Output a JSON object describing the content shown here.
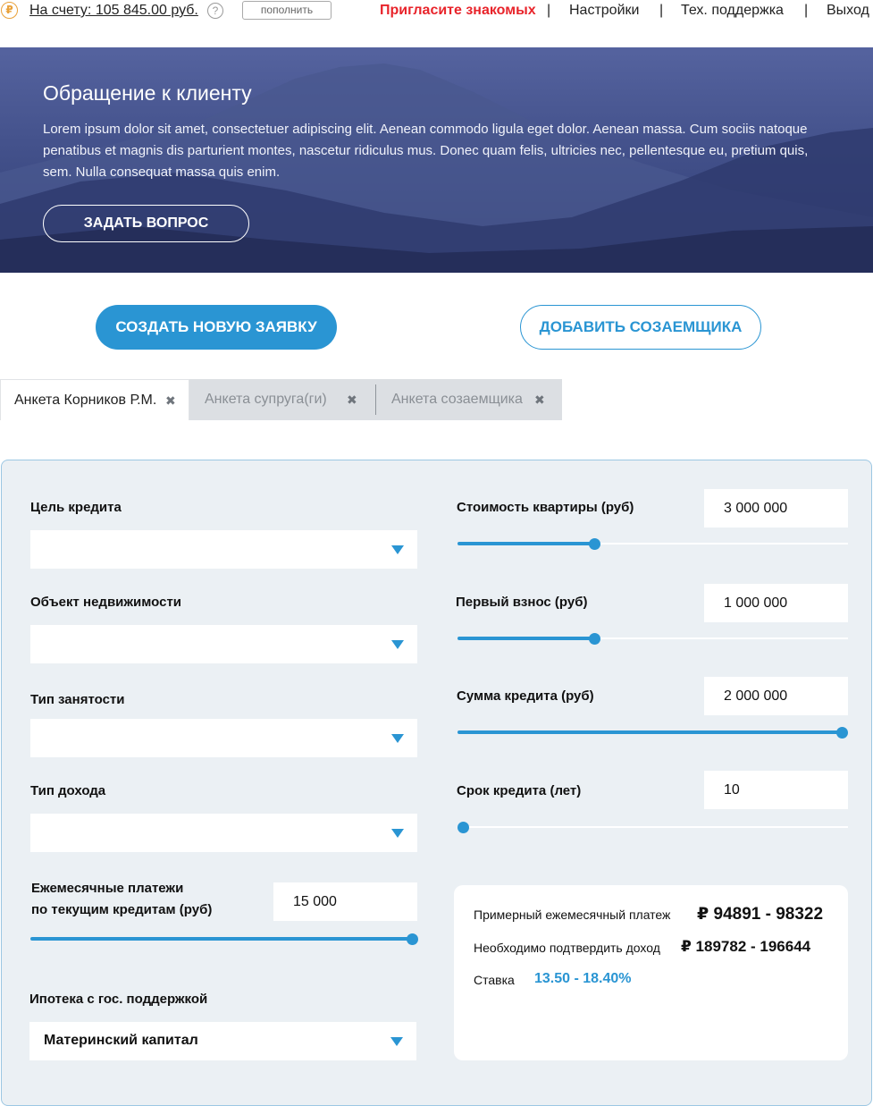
{
  "topbar": {
    "coin_icon": "ruble-coin-icon",
    "balance": "На счету: 105 845.00 руб.",
    "help_icon": "?",
    "topup_label": "пополнить",
    "invite": "Пригласите знакомых",
    "settings": "Настройки",
    "support": "Тех. поддержка",
    "logout": "Выход",
    "separator": "|"
  },
  "hero": {
    "title": "Обращение к клиенту",
    "text": "Lorem ipsum dolor sit amet, consectetuer adipiscing elit. Aenean commodo ligula eget dolor. Aenean massa. Cum sociis natoque penatibus et magnis dis parturient montes, nascetur ridiculus mus. Donec quam felis, ultricies nec, pellentesque eu, pretium quis, sem. Nulla consequat massa quis enim.",
    "button": "ЗАДАТЬ ВОПРОС"
  },
  "actions": {
    "create": "СОЗДАТЬ НОВУЮ ЗАЯВКУ",
    "add_coborrower": "ДОБАВИТЬ СОЗАЕМЩИКА"
  },
  "tabs": [
    {
      "label": "Анкета Корников Р.М.",
      "close": "✖",
      "active": true
    },
    {
      "label": "Анкета супруга(ги)",
      "close": "✖",
      "active": false
    },
    {
      "label": "Анкета созаемщика",
      "close": "✖",
      "active": false
    }
  ],
  "form": {
    "purpose_label": "Цель кредита",
    "property_label": "Объект недвижимости",
    "employment_label": "Тип занятости",
    "income_label": "Тип дохода",
    "monthly_label_line1": "Ежемесячные платежи",
    "monthly_label_line2": "по текущим кредитам (руб)",
    "monthly_value": "15 000",
    "monthly_slider": 1.0,
    "gov_label": "Ипотека с гос. поддержкой",
    "gov_value": "Материнский капитал",
    "price_label": "Стоимость квартиры (руб)",
    "price_value": "3 000 000",
    "price_slider": 0.35,
    "downpayment_label": "Первый взнос (руб)",
    "downpayment_value": "1 000 000",
    "downpayment_slider": 0.35,
    "loan_label": "Сумма кредита (руб)",
    "loan_value": "2 000 000",
    "loan_slider": 1.0,
    "term_label": "Срок кредита (лет)",
    "term_value": "10",
    "term_slider": 0.0
  },
  "result": {
    "payment_label": "Примерный ежемесячный платеж",
    "payment_value": "₽  94891 - 98322",
    "income_label": "Необходимо подтвердить доход",
    "income_value": "₽  189782 - 196644",
    "rate_label": "Ставка",
    "rate_value": "13.50 - 18.40%"
  },
  "colors": {
    "accent": "#2a95d3",
    "invite": "#e8242b",
    "panel_bg": "#ebf0f4",
    "panel_border": "#9cc7e3"
  }
}
